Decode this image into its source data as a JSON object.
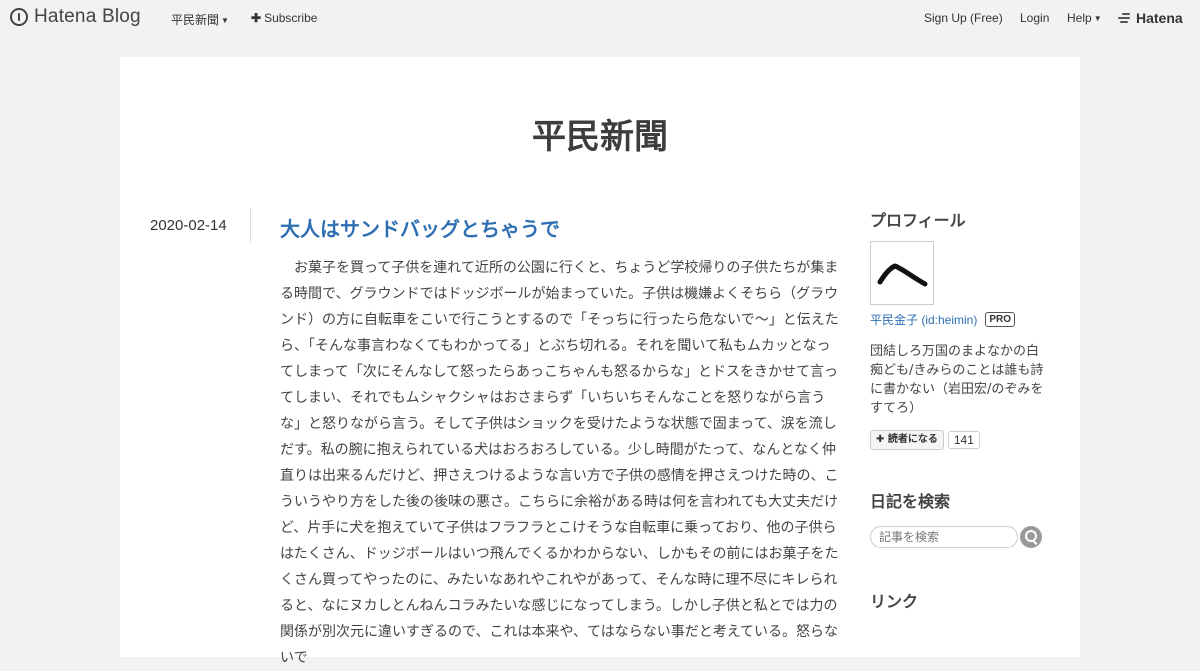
{
  "header": {
    "logo_text": "Hatena Blog",
    "blog_menu": "平民新聞",
    "subscribe": "Subscribe",
    "signup": "Sign Up (Free)",
    "login": "Login",
    "help": "Help",
    "brand": "Hatena"
  },
  "blog": {
    "title": "平民新聞"
  },
  "entry": {
    "date": "2020-02-14",
    "title": "大人はサンドバッグとちゃうで",
    "body": "お菓子を買って子供を連れて近所の公園に行くと、ちょうど学校帰りの子供たちが集まる時間で、グラウンドではドッジボールが始まっていた。子供は機嫌よくそちら（グラウンド）の方に自転車をこいで行こうとするので「そっちに行ったら危ないで〜」と伝えたら、「そんな事言わなくてもわかってる」とぶち切れる。それを聞いて私もムカッとなってしまって「次にそんなして怒ったらあっこちゃんも怒るからな」とドスをきかせて言ってしまい、それでもムシャクシャはおさまらず「いちいちそんなことを怒りながら言うな」と怒りながら言う。そして子供はショックを受けたような状態で固まって、涙を流しだす。私の腕に抱えられている犬はおろおろしている。少し時間がたって、なんとなく仲直りは出来るんだけど、押さえつけるような言い方で子供の感情を押さえつけた時の、こういうやり方をした後の後味の悪さ。こちらに余裕がある時は何を言われても大丈夫だけど、片手に犬を抱えていて子供はフラフラとこけそうな自転車に乗っており、他の子供らはたくさん、ドッジボールはいつ飛んでくるかわからない、しかもその前にはお菓子をたくさん買ってやったのに、みたいなあれやこれやがあって、そんな時に理不尽にキレられると、なにヌカしとんねんコラみたいな感じになってしまう。しかし子供と私とでは力の関係が別次元に違いすぎるので、これは本来や、てはならない事だと考えている。怒らないで"
  },
  "sidebar": {
    "profile_heading": "プロフィール",
    "profile_name": "平民金子 (id:heimin)",
    "pro_badge": "PRO",
    "profile_desc": "団結しろ万国のまよなかの白痴ども/きみらのことは誰も詩に書かない（岩田宏/のぞみをすてろ）",
    "reader_button": "読者になる",
    "reader_count": "141",
    "search_heading": "日記を検索",
    "search_placeholder": "記事を検索",
    "links_heading": "リンク"
  }
}
